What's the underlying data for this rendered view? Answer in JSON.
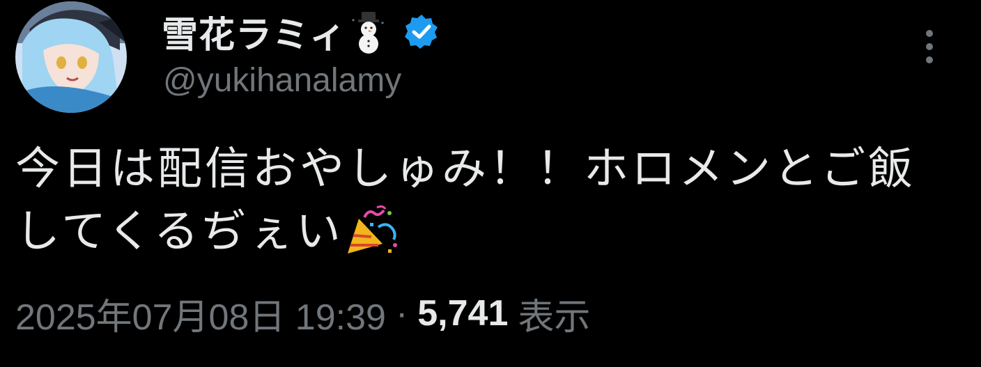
{
  "user": {
    "display_name": "雪花ラミィ",
    "handle": "@yukihanalamy",
    "name_emoji": "snowman-icon",
    "verified": true,
    "verified_color": "#1d9bf0",
    "avatar": "avatar-image"
  },
  "tweet": {
    "text": "今日は配信おやしゅみ！！ホロメンとご飯してくるぢぇい",
    "trailing_emoji": "party-popper-icon"
  },
  "meta": {
    "timestamp": "2025年07月08日 19:39",
    "separator": "·",
    "view_count": "5,741",
    "view_label": "表示"
  },
  "menu": {
    "icon": "more-vertical-icon"
  },
  "colors": {
    "background": "#000000",
    "text_primary": "#e7e9ea",
    "text_secondary": "#71767b"
  }
}
